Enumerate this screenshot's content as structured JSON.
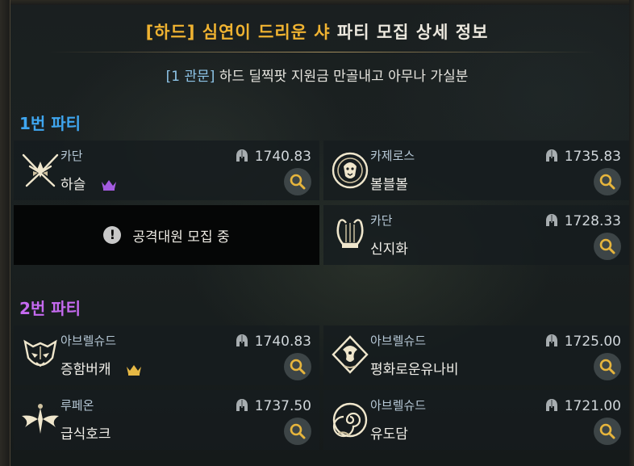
{
  "header": {
    "title_highlight": "[하드] 심연이 드리운 샤",
    "title_rest": "파티 모집 상세 정보",
    "subtitle_tag": "[1 관문]",
    "subtitle_text": "하드 딜찍팟 지원금 만골내고 아무나 가실분"
  },
  "colors": {
    "title_highlight": "#f0b331",
    "party1": "#3fa6f0",
    "party2": "#c56af0",
    "leader_crown_purple": "#a45be0",
    "leader_crown_gold": "#e6b845"
  },
  "parties": [
    {
      "label": "1번 파티",
      "members": [
        {
          "class": "카단",
          "name": "하슬",
          "ilvl": "1740.83",
          "emblem": "kadan-slayer-emblem-icon",
          "leader": true
        },
        {
          "class": "카제로스",
          "name": "볼블볼",
          "ilvl": "1735.83",
          "emblem": "lion-crest-emblem-icon",
          "leader": false
        },
        {
          "recruiting": true,
          "text": "공격대원 모집 중"
        },
        {
          "class": "카단",
          "name": "신지화",
          "ilvl": "1728.33",
          "emblem": "lyre-bard-emblem-icon",
          "leader": false
        }
      ]
    },
    {
      "label": "2번 파티",
      "members": [
        {
          "class": "아브렐슈드",
          "name": "증함버캐",
          "ilvl": "1740.83",
          "emblem": "demon-mask-emblem-icon",
          "leader": true
        },
        {
          "class": "아브렐슈드",
          "name": "평화로운유나비",
          "ilvl": "1725.00",
          "emblem": "dragon-shield-emblem-icon",
          "leader": false
        },
        {
          "class": "루페온",
          "name": "급식호크",
          "ilvl": "1737.50",
          "emblem": "winged-hawk-emblem-icon",
          "leader": false
        },
        {
          "class": "아브렐슈드",
          "name": "유도담",
          "ilvl": "1721.00",
          "emblem": "spiral-emblem-icon",
          "leader": false
        }
      ]
    }
  ]
}
